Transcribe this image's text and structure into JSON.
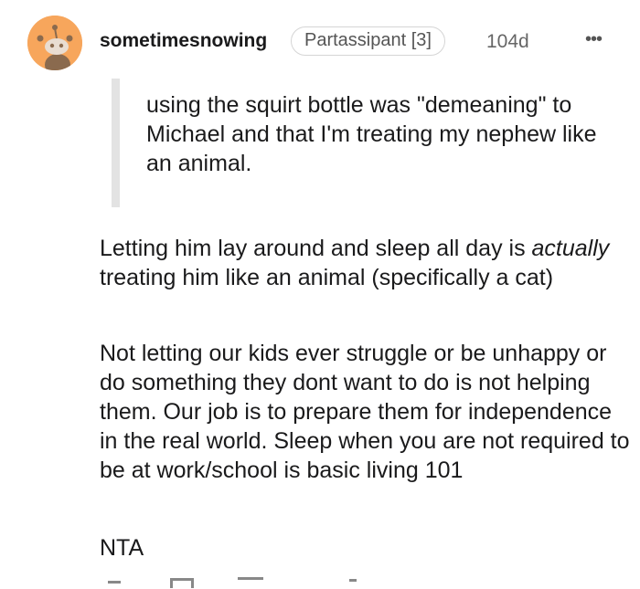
{
  "comment": {
    "username": "sometimesnowing",
    "flair": "Partassipant [3]",
    "age": "104d",
    "more_icon": "ellipsis-icon",
    "avatar_icon": "snoo-avatar-icon",
    "avatar_color": "#f7a65c",
    "quote": "using the squirt bottle was \"demeaning\" to Michael and that I'm treating my nephew like an animal.",
    "paragraph1": {
      "before": "Letting him lay around and sleep all day is ",
      "emphasis": "actually",
      "after": " treating him like an animal (specifically a cat)"
    },
    "paragraph2": "Not letting our kids ever struggle or be unhappy or do something they dont want to do is not helping them. Our job is to prepare them for independence in the real world. Sleep when you are not required to be at work/school is basic living 101",
    "paragraph3": "NTA"
  }
}
